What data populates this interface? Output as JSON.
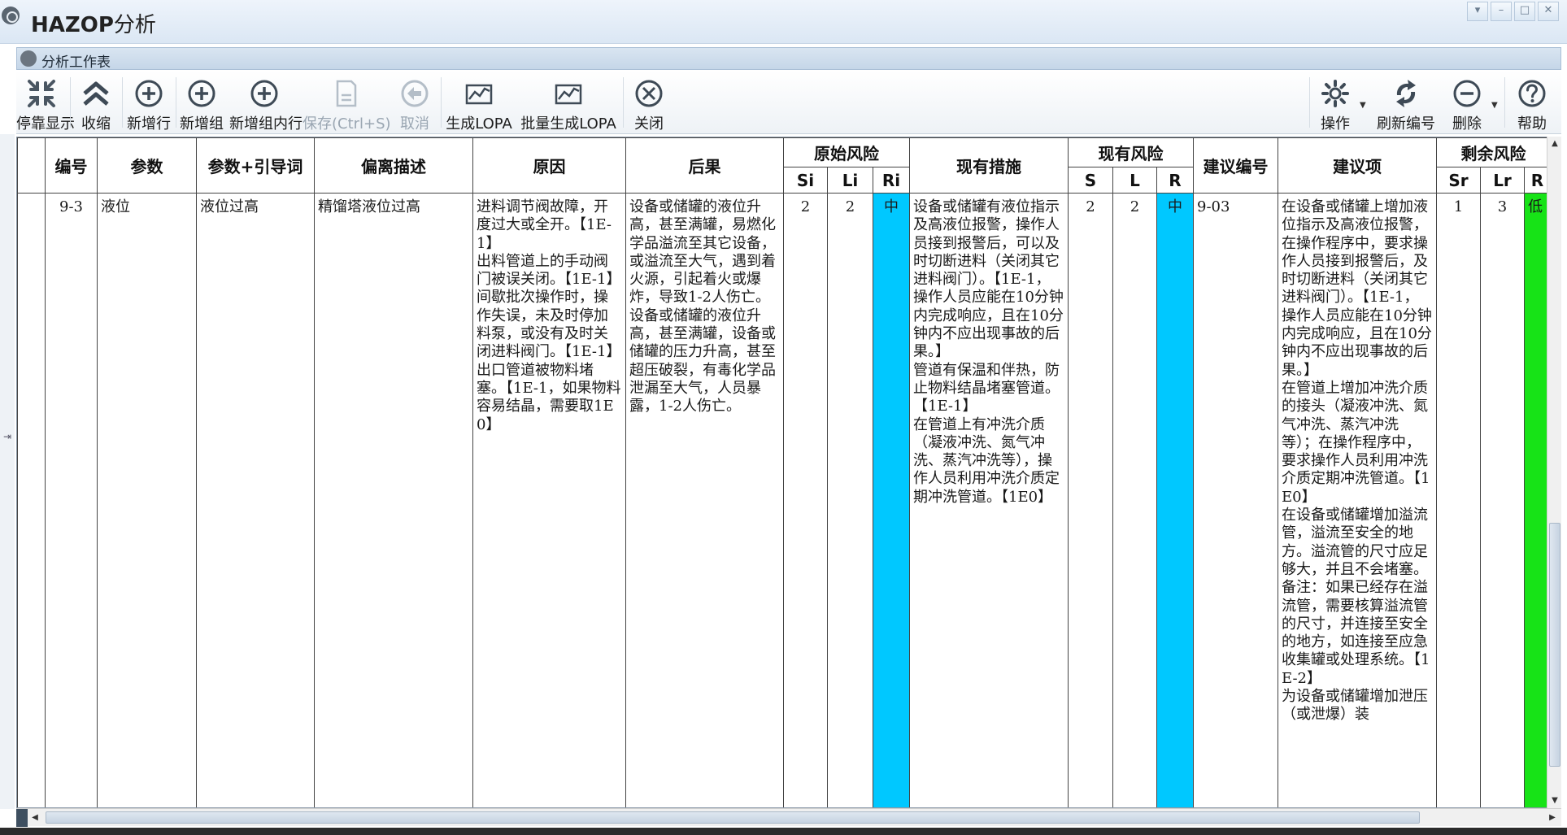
{
  "window": {
    "title_prefix": "HAZOP",
    "title_suffix": "分析",
    "controls": [
      "▾",
      "–",
      "□",
      "✕"
    ]
  },
  "panel": {
    "title": "分析工作表"
  },
  "toolbar": {
    "dock": "停靠显示",
    "collapse": "收缩",
    "add_row": "新增行",
    "add_group": "新增组",
    "add_group_row": "新增组内行",
    "save": "保存(Ctrl+S)",
    "cancel": "取消",
    "gen_lopa": "生成LOPA",
    "batch_lopa": "批量生成LOPA",
    "close": "关闭",
    "operate": "操作",
    "refresh_no": "刷新编号",
    "delete": "删除",
    "help": "帮助"
  },
  "grid": {
    "headers": {
      "no": "编号",
      "param": "参数",
      "param_guide": "参数+引导词",
      "deviation": "偏离描述",
      "cause": "原因",
      "consequence": "后果",
      "orig_risk": "原始风险",
      "si": "Si",
      "li": "Li",
      "ri": "Ri",
      "measures": "现有措施",
      "cur_risk": "现有风险",
      "s": "S",
      "l": "L",
      "r": "R",
      "sugg_no": "建议编号",
      "suggestion": "建议项",
      "res_risk": "剩余风险",
      "sr": "Sr",
      "lr": "Lr",
      "rr": "R"
    },
    "row": {
      "no": "9-3",
      "param": "液位",
      "param_guide": "液位过高",
      "deviation": "精馏塔液位过高",
      "cause": [
        "进料调节阀故障，开度过大或全开。【1E-1】",
        "出料管道上的手动阀门被误关闭。【1E-1】",
        "间歇批次操作时，操作失误，未及时停加料泵，或没有及时关闭进料阀门。【1E-1】",
        "出口管道被物料堵塞。【1E-1，如果物料容易结晶，需要取1E0】"
      ],
      "consequence": [
        "设备或储罐的液位升高，甚至满罐，易燃化学品溢流至其它设备，或溢流至大气，遇到着火源，引起着火或爆炸，导致1-2人伤亡。",
        "设备或储罐的液位升高，甚至满罐，设备或储罐的压力升高，甚至超压破裂，有毒化学品泄漏至大气，人员暴露，1-2人伤亡。"
      ],
      "si": "2",
      "li": "2",
      "ri": "中",
      "measures": [
        "设备或储罐有液位指示及高液位报警，操作人员接到报警后，可以及时切断进料（关闭其它进料阀门）。【1E-1，操作人员应能在10分钟内完成响应，且在10分钟内不应出现事故的后果。】",
        "管道有保温和伴热，防止物料结晶堵塞管道。【1E-1】",
        "在管道上有冲洗介质（凝液冲洗、氮气冲洗、蒸汽冲洗等），操作人员利用冲洗介质定期冲洗管道。【1E0】"
      ],
      "s": "2",
      "l": "2",
      "r": "中",
      "sugg_no": "9-03",
      "suggestion": [
        "在设备或储罐上增加液位指示及高液位报警，在操作程序中，要求操作人员接到报警后，及时切断进料（关闭其它进料阀门）。【1E-1，操作人员应能在10分钟内完成响应，且在10分钟内不应出现事故的后果。】",
        "在管道上增加冲洗介质的接头（凝液冲洗、氮气冲洗、蒸汽冲洗等）；在操作程序中，要求操作人员利用冲洗介质定期冲洗管道。【1E0】",
        "在设备或储罐增加溢流管，溢流至安全的地方。溢流管的尺寸应足够大，并且不会堵塞。备注：如果已经存在溢流管，需要核算溢流管的尺寸，并连接至安全的地方，如连接至应急收集罐或处理系统。【1E-2】",
        "为设备或储罐增加泄压（或泄爆）装"
      ],
      "sr": "1",
      "lr": "3",
      "rr": "低"
    }
  },
  "colors": {
    "ri_cell": "#00c8ff",
    "rr_cell": "#17e317",
    "title_bar": "#dbe7f4"
  }
}
